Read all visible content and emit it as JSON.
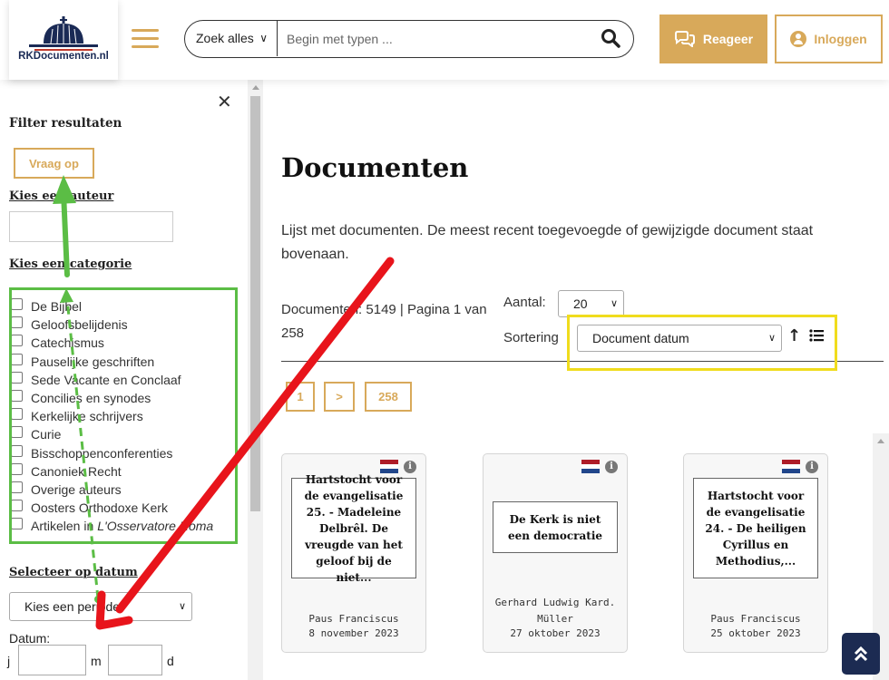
{
  "header": {
    "logo_text": "RKDocumenten.nl",
    "search_scope": "Zoek alles",
    "search_placeholder": "Begin met typen ...",
    "reageer_label": "Reageer",
    "inloggen_label": "Inloggen",
    "accent_color": "#d8a95a"
  },
  "sidebar": {
    "filter_title": "Filter resultaten",
    "vraag_op_label": "Vraag op",
    "auteur_label": "Kies een auteur",
    "categorie_label": "Kies een categorie",
    "categories": [
      "De Bijbel",
      "Geloofsbelijdenis",
      "Catechismus",
      "Pauselijke geschriften",
      "Sede Vacante en Conclaaf",
      "Concilies en synodes",
      "Kerkelijke schrijvers",
      "Curie",
      "Bisschoppenconferenties",
      "Canoniek Recht",
      "Overige auteurs",
      "Oosters Orthodoxe Kerk",
      "Artikelen in"
    ],
    "last_category_italic": "L'Osservatore Roma",
    "datum_section_label": "Selecteer op datum",
    "periode_select": "Kies een periode",
    "datum_label": "Datum:",
    "j_label": "j",
    "m_label": "m",
    "d_label": "d"
  },
  "main": {
    "title": "Documenten",
    "intro": "Lijst met documenten. De meest recent toegevoegde of gewijzigde document staat bovenaan.",
    "count_text": "Documenten: 5149 | Pagina 1 van 258",
    "aantal_label": "Aantal:",
    "aantal_value": "20",
    "sortering_label": "Sortering",
    "sortering_value": "Document datum",
    "sort_direction_icon": "↑",
    "pagination": [
      "1",
      ">",
      "258"
    ]
  },
  "cards": [
    {
      "title": "Hartstocht voor de evangelisatie 25. - Madeleine Delbrêl. De vreugde van het geloof bij de niet...",
      "author": "Paus Franciscus",
      "date": "8 november 2023"
    },
    {
      "title": "De Kerk is niet een democratie",
      "author": "Gerhard Ludwig Kard. Müller",
      "date": "27 oktober 2023"
    },
    {
      "title": "Hartstocht voor de evangelisatie 24. - De heiligen Cyrillus en Methodius,...",
      "author": "Paus Franciscus",
      "date": "25 oktober 2023"
    }
  ],
  "annotation_colors": {
    "green": "#5bbd45",
    "yellow": "#f0dc1d",
    "red": "#e8141b"
  }
}
